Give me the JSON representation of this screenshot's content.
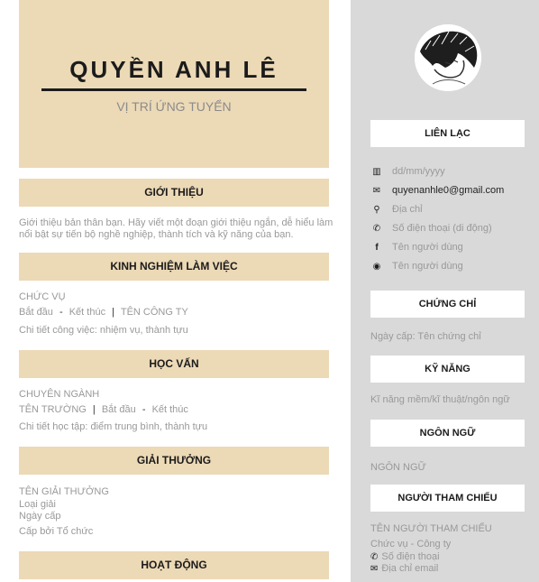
{
  "header": {
    "name": "QUYỀN ANH LÊ",
    "position": "VỊ TRÍ ỨNG TUYỂN"
  },
  "intro": {
    "title": "GIỚI THIỆU",
    "line1": "Giới thiệu bản thân bạn. Hãy viết một đoạn giới thiệu ngắn, dễ hiểu làm",
    "line2": "nổi bật sự tiến bộ nghề nghiệp, thành tích và kỹ năng của bạn."
  },
  "experience": {
    "title": "KINH NGHIỆM LÀM VIỆC",
    "role": "CHỨC VỤ",
    "start": "Bắt đầu",
    "dash": "-",
    "end": "Kết thúc",
    "bar": "|",
    "company": "TÊN CÔNG TY",
    "detail": "Chi tiết công việc: nhiệm vụ, thành tựu"
  },
  "education": {
    "title": "HỌC VẤN",
    "major": "CHUYÊN NGÀNH",
    "school": "TÊN TRƯỜNG",
    "bar": "|",
    "start": "Bắt đầu",
    "dash": "-",
    "end": "Kết thúc",
    "detail": "Chi tiết học tập: điểm trung bình, thành tựu"
  },
  "awards": {
    "title": "GIẢI THƯỞNG",
    "name": "TÊN GIẢI THƯỞNG",
    "type": "Loại giải",
    "date": "Ngày cấp",
    "issuer": "Cấp bởi Tổ chức"
  },
  "activities": {
    "title": "HOẠT ĐỘNG"
  },
  "contact": {
    "title": "LIÊN LẠC",
    "items": [
      {
        "icon": "birthday-cake-icon",
        "glyph": "▥",
        "text": "dd/mm/yyyy"
      },
      {
        "icon": "envelope-icon",
        "glyph": "✉",
        "text": "quyenanhle0@gmail.com"
      },
      {
        "icon": "map-pin-icon",
        "glyph": "⚲",
        "text": "Địa chỉ"
      },
      {
        "icon": "phone-icon",
        "glyph": "✆",
        "text": "Số điện thoại (di động)"
      },
      {
        "icon": "facebook-icon",
        "glyph": "f",
        "text": "Tên người dùng"
      },
      {
        "icon": "github-icon",
        "glyph": "◉",
        "text": "Tên người dùng"
      }
    ]
  },
  "certificates": {
    "title": "CHỨNG CHỈ",
    "date_label": "Ngày cấp:",
    "name": "Tên chứng chỉ"
  },
  "skills": {
    "title": "KỸ NĂNG",
    "text": "Kĩ năng mềm/kĩ thuật/ngôn ngữ"
  },
  "languages": {
    "title": "NGÔN NGỮ",
    "text": "NGÔN NGỮ"
  },
  "references": {
    "title": "NGƯỜI THAM CHIẾU",
    "name": "TÊN NGƯỜI THAM CHIẾU",
    "role": "Chức vụ - Công ty",
    "phone": "Số điện thoại",
    "email": "Địa chỉ email",
    "phone_glyph": "✆",
    "email_glyph": "✉"
  }
}
